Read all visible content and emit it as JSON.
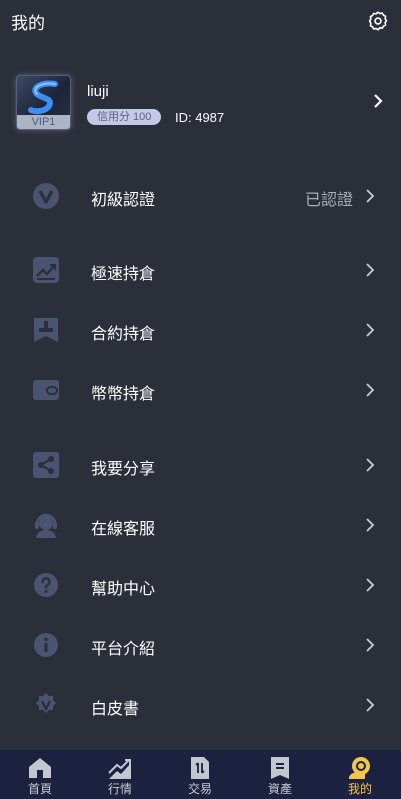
{
  "header": {
    "title": "我的",
    "settings_icon": "gear-icon"
  },
  "profile": {
    "username": "liuji",
    "vip_badge": "VIP1",
    "credit_label": "信用分 100",
    "user_id": "ID: 4987"
  },
  "menu": [
    {
      "label": "初級認證",
      "value": "已認證",
      "icon": "verified-v-icon"
    },
    {
      "label": "極速持倉",
      "icon": "trend-chart-icon"
    },
    {
      "label": "合約持倉",
      "icon": "stamp-icon"
    },
    {
      "label": "幣幣持倉",
      "icon": "wallet-icon"
    },
    {
      "label": "我要分享",
      "icon": "share-icon"
    },
    {
      "label": "在線客服",
      "icon": "headset-icon"
    },
    {
      "label": "幫助中心",
      "icon": "help-icon"
    },
    {
      "label": "平台介紹",
      "icon": "info-icon"
    },
    {
      "label": "白皮書",
      "icon": "whitepaper-badge-icon"
    }
  ],
  "tabs": [
    {
      "label": "首頁",
      "icon": "home-icon"
    },
    {
      "label": "行情",
      "icon": "market-icon"
    },
    {
      "label": "交易",
      "icon": "trade-icon"
    },
    {
      "label": "資產",
      "icon": "assets-icon"
    },
    {
      "label": "我的",
      "icon": "profile-coin-icon",
      "active": true
    }
  ],
  "colors": {
    "background": "#2b2f3a",
    "tabbar": "#1c2140",
    "active_tab": "#f3c64a",
    "icon": "#4a5470"
  }
}
